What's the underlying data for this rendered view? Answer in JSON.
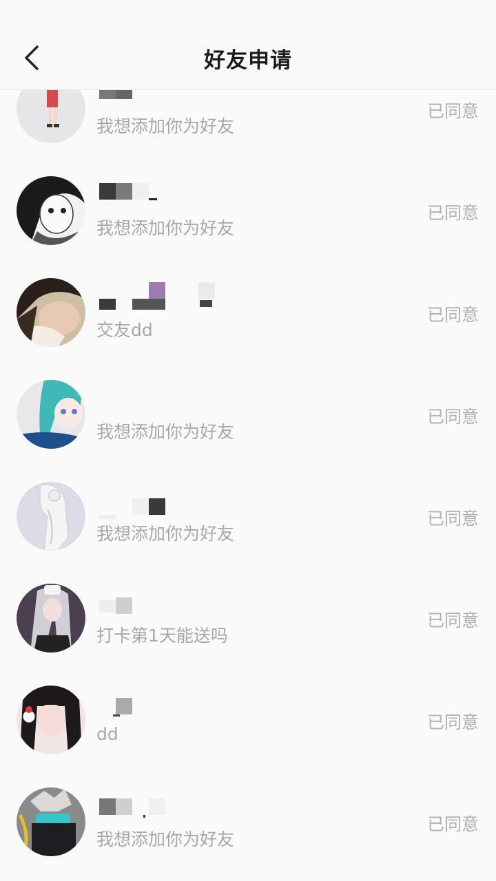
{
  "header": {
    "title": "好友申请",
    "back_icon": "chevron-left-icon"
  },
  "requests": [
    {
      "message": "我想添加你为好友",
      "status": "已同意"
    },
    {
      "message": "我想添加你为好友",
      "status": "已同意"
    },
    {
      "message": "交友dd",
      "status": "已同意"
    },
    {
      "message": "我想添加你为好友",
      "status": "已同意"
    },
    {
      "message": "我想添加你为好友",
      "status": "已同意"
    },
    {
      "message": "打卡第1天能送吗",
      "status": "已同意"
    },
    {
      "message": "dd",
      "status": "已同意"
    },
    {
      "message": "我想添加你为好友",
      "status": "已同意"
    }
  ]
}
